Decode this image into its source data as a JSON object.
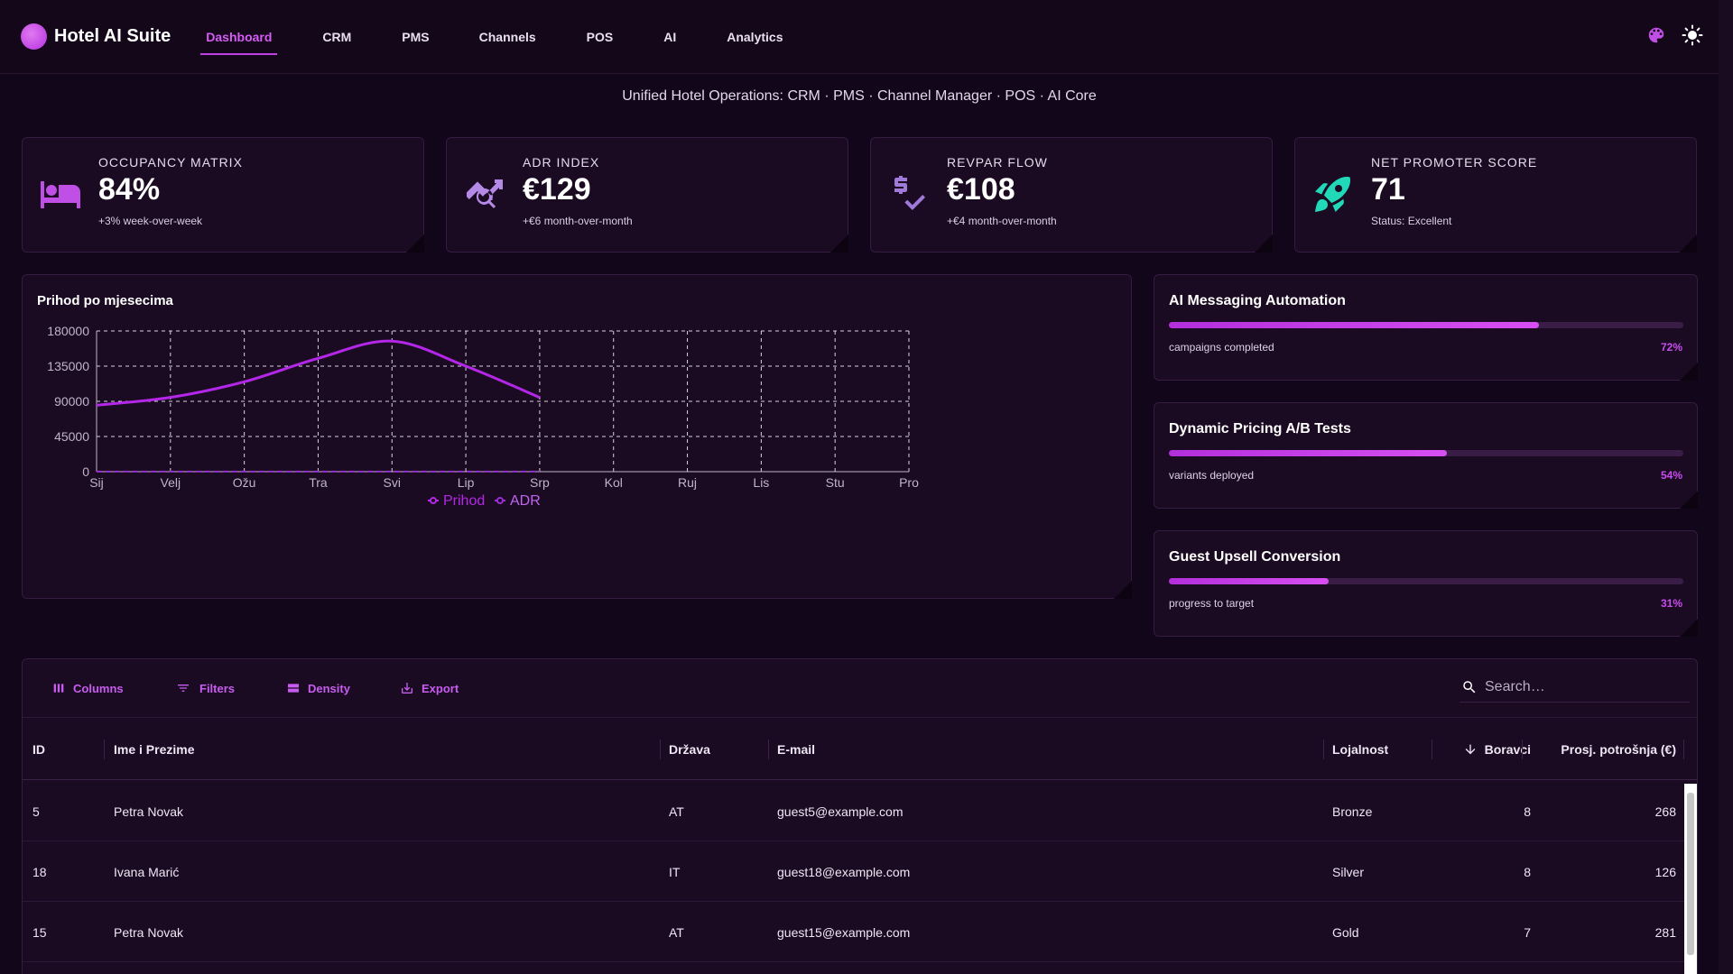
{
  "app": {
    "title": "Hotel AI Suite",
    "subtitle": "Unified Hotel Operations: CRM · PMS · Channel Manager · POS · AI Core"
  },
  "nav": {
    "items": [
      {
        "label": "Dashboard",
        "active": true
      },
      {
        "label": "CRM"
      },
      {
        "label": "PMS"
      },
      {
        "label": "Channels"
      },
      {
        "label": "POS"
      },
      {
        "label": "AI"
      },
      {
        "label": "Analytics"
      }
    ]
  },
  "header_icons": [
    "palette-icon",
    "sun-icon"
  ],
  "kpis": [
    {
      "label": "OCCUPANCY MATRIX",
      "value": "84%",
      "note": "+3% week-over-week",
      "icon": "bed-icon",
      "color": "#c04fe6"
    },
    {
      "label": "ADR INDEX",
      "value": "€129",
      "note": "+€6 month-over-month",
      "icon": "trend-search-icon",
      "color": "#b58ae6"
    },
    {
      "label": "REVPAR FLOW",
      "value": "€108",
      "note": "+€4 month-over-month",
      "icon": "price-check-icon",
      "color": "#a07ad8"
    },
    {
      "label": "NET PROMOTER SCORE",
      "value": "71",
      "note": "Status: Excellent",
      "icon": "rocket-icon",
      "color": "#21d9b8"
    }
  ],
  "chart": {
    "title": "Prihod po mjesecima",
    "legend": [
      "Prihod",
      "ADR"
    ]
  },
  "chart_data": {
    "type": "line",
    "categories": [
      "Sij",
      "Velj",
      "Ožu",
      "Tra",
      "Svi",
      "Lip",
      "Srp",
      "Kol",
      "Ruj",
      "Lis",
      "Stu",
      "Pro"
    ],
    "series": [
      {
        "name": "Prihod",
        "values": [
          85000,
          95000,
          115000,
          145000,
          167000,
          135000,
          95000,
          null,
          null,
          null,
          null,
          null
        ],
        "color": "#b427e8"
      },
      {
        "name": "ADR",
        "values": [
          110,
          115,
          120,
          125,
          132,
          128,
          129,
          null,
          null,
          null,
          null,
          null
        ],
        "color": "#9a2ed6"
      }
    ],
    "yticks": [
      "180000",
      "135000",
      "90000",
      "45000",
      "0"
    ],
    "ylim": [
      0,
      180000
    ],
    "grid": true,
    "legend_position": "bottom"
  },
  "progress_cards": [
    {
      "title": "AI Messaging Automation",
      "caption": "campaigns completed",
      "percent": 72,
      "percent_label": "72%"
    },
    {
      "title": "Dynamic Pricing A/B Tests",
      "caption": "variants deployed",
      "percent": 54,
      "percent_label": "54%"
    },
    {
      "title": "Guest Upsell Conversion",
      "caption": "progress to target",
      "percent": 31,
      "percent_label": "31%"
    }
  ],
  "grid": {
    "toolbar": {
      "columns": "Columns",
      "filters": "Filters",
      "density": "Density",
      "export": "Export"
    },
    "search_placeholder": "Search…",
    "headers": {
      "id": "ID",
      "name": "Ime i Prezime",
      "country": "Država",
      "email": "E-mail",
      "loyalty": "Lojalnost",
      "stays": "Boravci",
      "spend": "Prosj. potrošnja (€)"
    },
    "rows": [
      {
        "id": "5",
        "name": "Petra Novak",
        "country": "AT",
        "email": "guest5@example.com",
        "loyalty": "Bronze",
        "stays": "8",
        "spend": "268"
      },
      {
        "id": "18",
        "name": "Ivana Marić",
        "country": "IT",
        "email": "guest18@example.com",
        "loyalty": "Silver",
        "stays": "8",
        "spend": "126"
      },
      {
        "id": "15",
        "name": "Petra Novak",
        "country": "AT",
        "email": "guest15@example.com",
        "loyalty": "Gold",
        "stays": "7",
        "spend": "281"
      }
    ]
  }
}
